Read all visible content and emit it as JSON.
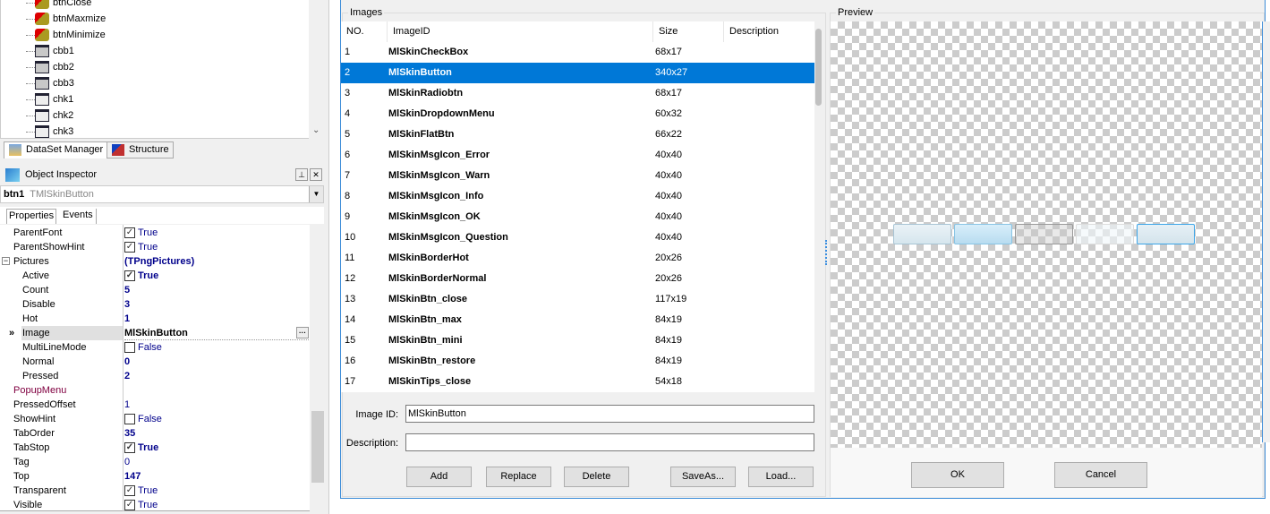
{
  "tree": {
    "items": [
      {
        "label": "btnClose",
        "icon": "button-component-icon"
      },
      {
        "label": "btnMaxmize",
        "icon": "button-component-icon"
      },
      {
        "label": "btnMinimize",
        "icon": "button-component-icon"
      },
      {
        "label": "cbb1",
        "icon": "combobox-component-icon"
      },
      {
        "label": "cbb2",
        "icon": "combobox-component-icon"
      },
      {
        "label": "cbb3",
        "icon": "combobox-component-icon"
      },
      {
        "label": "chk1",
        "icon": "checkbox-component-icon"
      },
      {
        "label": "chk2",
        "icon": "checkbox-component-icon"
      },
      {
        "label": "chk3",
        "icon": "checkbox-component-icon"
      }
    ]
  },
  "bottom_tabs": [
    "DataSet Manager",
    "Structure"
  ],
  "inspector": {
    "title": "Object Inspector",
    "object_name": "btn1",
    "object_type": "TMlSkinButton",
    "tabs": [
      "Properties",
      "Events"
    ],
    "properties": [
      {
        "name": "ParentFont",
        "value": "True",
        "check": true,
        "bold": false
      },
      {
        "name": "ParentShowHint",
        "value": "True",
        "check": true,
        "bold": false
      },
      {
        "name": "Pictures",
        "value": "(TPngPictures)",
        "bold": true,
        "expander": "−"
      },
      {
        "name": "Active",
        "value": "True",
        "check": true,
        "bold": true,
        "sub": true
      },
      {
        "name": "Count",
        "value": "5",
        "bold": true,
        "sub": true
      },
      {
        "name": "Disable",
        "value": "3",
        "bold": true,
        "sub": true
      },
      {
        "name": "Hot",
        "value": "1",
        "bold": true,
        "sub": true
      },
      {
        "name": "Image",
        "value": "MlSkinButton",
        "bold": true,
        "sub": true,
        "selected": true
      },
      {
        "name": "MultiLineMode",
        "value": "False",
        "check": false,
        "bold": false,
        "sub": true
      },
      {
        "name": "Normal",
        "value": "0",
        "bold": true,
        "sub": true
      },
      {
        "name": "Pressed",
        "value": "2",
        "bold": true,
        "sub": true
      },
      {
        "name": "PopupMenu",
        "value": "",
        "event": true
      },
      {
        "name": "PressedOffset",
        "value": "1",
        "bold": false
      },
      {
        "name": "ShowHint",
        "value": "False",
        "check": false,
        "bold": false
      },
      {
        "name": "TabOrder",
        "value": "35",
        "bold": true
      },
      {
        "name": "TabStop",
        "value": "True",
        "check": true,
        "bold": true
      },
      {
        "name": "Tag",
        "value": "0",
        "bold": false
      },
      {
        "name": "Top",
        "value": "147",
        "bold": true
      },
      {
        "name": "Transparent",
        "value": "True",
        "check": true,
        "bold": false
      },
      {
        "name": "Visible",
        "value": "True",
        "check": true,
        "bold": false
      }
    ]
  },
  "dialog": {
    "images_group": "Images",
    "preview_group": "Preview",
    "columns": [
      "NO.",
      "ImageID",
      "Size",
      "Description"
    ],
    "rows": [
      [
        "1",
        "MlSkinCheckBox",
        "68x17",
        ""
      ],
      [
        "2",
        "MlSkinButton",
        "340x27",
        ""
      ],
      [
        "3",
        "MlSkinRadiobtn",
        "68x17",
        ""
      ],
      [
        "4",
        "MlSkinDropdownMenu",
        "60x32",
        ""
      ],
      [
        "5",
        "MlSkinFlatBtn",
        "66x22",
        ""
      ],
      [
        "6",
        "MlSkinMsgIcon_Error",
        "40x40",
        ""
      ],
      [
        "7",
        "MlSkinMsgIcon_Warn",
        "40x40",
        ""
      ],
      [
        "8",
        "MlSkinMsgIcon_Info",
        "40x40",
        ""
      ],
      [
        "9",
        "MlSkinMsgIcon_OK",
        "40x40",
        ""
      ],
      [
        "10",
        "MlSkinMsgIcon_Question",
        "40x40",
        ""
      ],
      [
        "11",
        "MlSkinBorderHot",
        "20x26",
        ""
      ],
      [
        "12",
        "MlSkinBorderNormal",
        "20x26",
        ""
      ],
      [
        "13",
        "MlSkinBtn_close",
        "117x19",
        ""
      ],
      [
        "14",
        "MlSkinBtn_max",
        "84x19",
        ""
      ],
      [
        "15",
        "MlSkinBtn_mini",
        "84x19",
        ""
      ],
      [
        "16",
        "MlSkinBtn_restore",
        "84x19",
        ""
      ],
      [
        "17",
        "MlSkinTips_close",
        "54x18",
        ""
      ]
    ],
    "selected_row": 2,
    "image_id_label": "Image ID:",
    "image_id_value": "MlSkinButton",
    "description_label": "Description:",
    "description_value": "",
    "buttons": {
      "add": "Add",
      "replace": "Replace",
      "delete": "Delete",
      "saveas": "SaveAs...",
      "load": "Load...",
      "ok": "OK",
      "cancel": "Cancel"
    },
    "selection_color": "#0078d7"
  }
}
